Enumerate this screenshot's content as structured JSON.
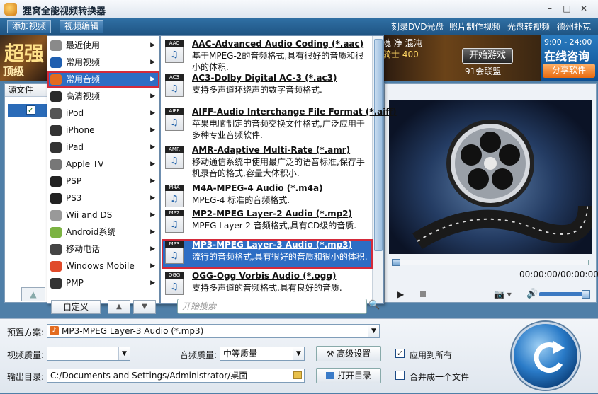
{
  "window": {
    "title": "狸窝全能视频转换器",
    "min": "–",
    "max": "□",
    "close": "✕"
  },
  "toolbar": {
    "add_video": "添加视频",
    "edit_video": "视频编辑",
    "links": [
      "刻录DVD光盘",
      "照片制作视频",
      "光盘转视频",
      "德州扑克"
    ]
  },
  "banner": {
    "left_big": "超强",
    "left_small": "顶级",
    "game_line1": "魂 净 混沌",
    "game_line2": "骑士 400",
    "play_button": "开始游戏",
    "union": "91会联盟",
    "consult_hours": "9:00 - 24:00",
    "consult_title": "在线咨询",
    "share_button": "分享软件"
  },
  "file_panel": {
    "header": "源文件",
    "check": "✓",
    "up": "▲"
  },
  "category_menu": {
    "items": [
      {
        "label": "最近使用",
        "icon": "clock-icon",
        "color": "#8a8a8a"
      },
      {
        "label": "常用视频",
        "icon": "film-icon",
        "color": "#1f5fb0"
      },
      {
        "label": "常用音频",
        "icon": "music-icon",
        "color": "#e36b1f",
        "selected": true
      },
      {
        "label": "高清视频",
        "icon": "hd-icon",
        "color": "#2b2b2b"
      },
      {
        "label": "iPod",
        "icon": "ipod-icon",
        "color": "#555555"
      },
      {
        "label": "iPhone",
        "icon": "iphone-icon",
        "color": "#333333"
      },
      {
        "label": "iPad",
        "icon": "ipad-icon",
        "color": "#333333"
      },
      {
        "label": "Apple TV",
        "icon": "apple-icon",
        "color": "#777777"
      },
      {
        "label": "PSP",
        "icon": "psp-icon",
        "color": "#222222"
      },
      {
        "label": "PS3",
        "icon": "ps3-icon",
        "color": "#222222"
      },
      {
        "label": "Wii and DS",
        "icon": "wii-icon",
        "color": "#999999"
      },
      {
        "label": "Android系统",
        "icon": "android-icon",
        "color": "#7cb342"
      },
      {
        "label": "移动电话",
        "icon": "phone-icon",
        "color": "#444444"
      },
      {
        "label": "Windows Mobile",
        "icon": "windows-icon",
        "color": "#e04a2a"
      },
      {
        "label": "PMP",
        "icon": "pmp-icon",
        "color": "#333333"
      }
    ],
    "arrow": "▶"
  },
  "format_menu": {
    "items": [
      {
        "tag": "AAC",
        "title": "AAC-Advanced Audio Coding (*.aac)",
        "desc": "基于MPEG-2的音频格式,具有很好的音质和很小的体积."
      },
      {
        "tag": "AC3",
        "title": "AC3-Dolby Digital AC-3 (*.ac3)",
        "desc": "支持多声道环绕声的数字音频格式."
      },
      {
        "tag": "AIFF",
        "title": "AIFF-Audio Interchange File Format (*.aiff)",
        "desc": "苹果电脑制定的音频交换文件格式,广泛应用于多种专业音频软件."
      },
      {
        "tag": "AMR",
        "title": "AMR-Adaptive Multi-Rate (*.amr)",
        "desc": "移动通信系统中使用最广泛的语音标准,保存手机录音的格式,容量大体积小."
      },
      {
        "tag": "M4A",
        "title": "M4A-MPEG-4 Audio (*.m4a)",
        "desc": "MPEG-4 标准的音频格式."
      },
      {
        "tag": "MP2",
        "title": "MP2-MPEG Layer-2 Audio (*.mp2)",
        "desc": "MPEG Layer-2 音频格式,具有CD级的音质."
      },
      {
        "tag": "MP3",
        "title": "MP3-MPEG Layer-3 Audio (*.mp3)",
        "desc": "流行的音频格式,具有很好的音质和很小的体积.",
        "selected": true
      },
      {
        "tag": "OGG",
        "title": "OGG-Ogg Vorbis Audio (*.ogg)",
        "desc": "支持多声道的音频格式,具有良好的音质."
      }
    ],
    "custom_button": "自定义",
    "up_button": "▲",
    "down_button": "▼",
    "search_placeholder": "开始搜索",
    "search_icon": "🔍"
  },
  "preview": {
    "time": "00:00:00/00:00:00",
    "play": "▶",
    "camera": "📷 ▾",
    "volume": "🔊"
  },
  "settings": {
    "preset_label": "预置方案:",
    "preset_value": "MP3-MPEG Layer-3 Audio (*.mp3)",
    "video_quality_label": "视频质量:",
    "video_quality_value": "",
    "audio_quality_label": "音频质量:",
    "audio_quality_value": "中等质量",
    "advanced_button": "高级设置",
    "apply_all_label": "应用到所有",
    "apply_all_checked": "✓",
    "output_label": "输出目录:",
    "output_path": "C:/Documents and Settings/Administrator/桌面",
    "open_dir_button": "打开目录",
    "merge_label": "合并成一个文件"
  }
}
